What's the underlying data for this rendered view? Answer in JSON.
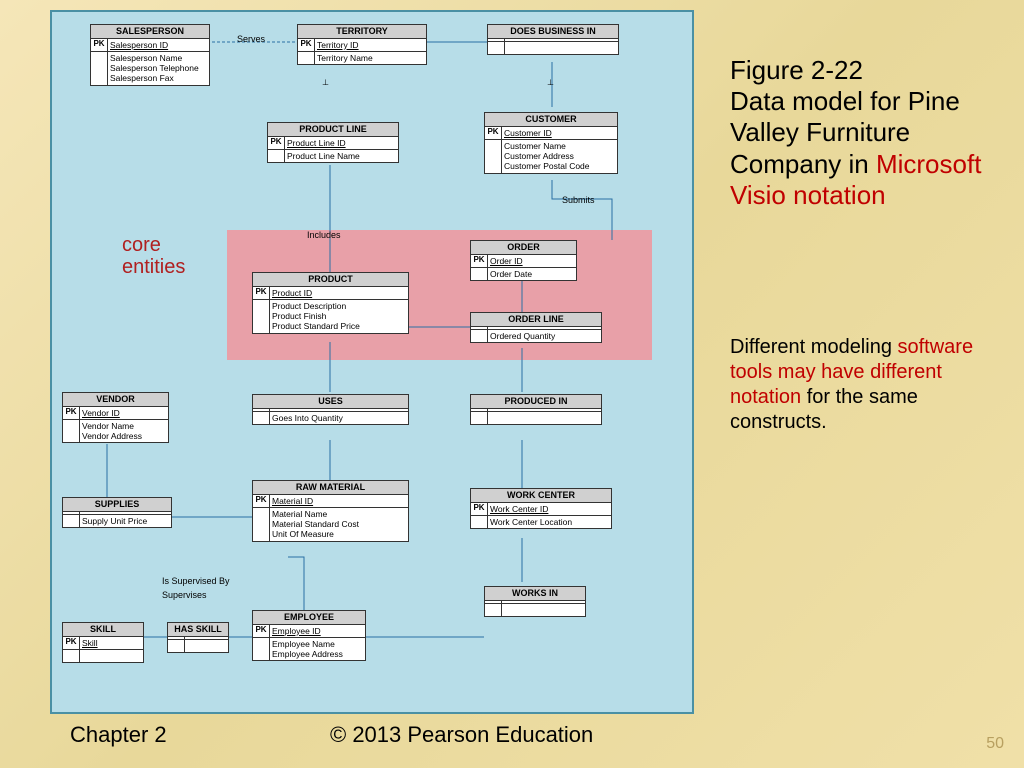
{
  "figure_number": "Figure 2-22",
  "figure_title_plain": "Data model for Pine Valley Furniture Company in ",
  "figure_title_red": "Microsoft Visio notation",
  "subtitle_pre": "Different modeling ",
  "subtitle_red": "software tools may have different notation",
  "subtitle_post": " for the same constructs.",
  "annotation": "core entities",
  "footer_chapter": "Chapter 2",
  "footer_copyright": "© 2013 Pearson Education",
  "page_number": "50",
  "entities": {
    "salesperson": {
      "title": "SALESPERSON",
      "pk": "Salesperson ID",
      "attrs": "Salesperson Name\nSalesperson Telephone\nSalesperson Fax"
    },
    "territory": {
      "title": "TERRITORY",
      "pk": "Territory ID",
      "attrs": "Territory Name"
    },
    "does_business_in": {
      "title": "DOES BUSINESS IN",
      "pk": "",
      "attrs": ""
    },
    "product_line": {
      "title": "PRODUCT LINE",
      "pk": "Product Line ID",
      "attrs": "Product Line Name"
    },
    "customer": {
      "title": "CUSTOMER",
      "pk": "Customer ID",
      "attrs": "Customer Name\nCustomer Address\nCustomer Postal Code"
    },
    "order": {
      "title": "ORDER",
      "pk": "Order ID",
      "attrs": "Order Date"
    },
    "product": {
      "title": "PRODUCT",
      "pk": "Product ID",
      "attrs": "Product Description\nProduct Finish\nProduct Standard Price"
    },
    "order_line": {
      "title": "ORDER LINE",
      "pk": "",
      "attrs": "Ordered Quantity"
    },
    "vendor": {
      "title": "VENDOR",
      "pk": "Vendor ID",
      "attrs": "Vendor Name\nVendor Address"
    },
    "uses": {
      "title": "USES",
      "pk": "",
      "attrs": "Goes Into Quantity"
    },
    "produced_in": {
      "title": "PRODUCED IN",
      "pk": "",
      "attrs": ""
    },
    "supplies": {
      "title": "SUPPLIES",
      "pk": "",
      "attrs": "Supply Unit Price"
    },
    "raw_material": {
      "title": "RAW MATERIAL",
      "pk": "Material ID",
      "attrs": "Material Name\nMaterial Standard Cost\nUnit Of Measure"
    },
    "work_center": {
      "title": "WORK CENTER",
      "pk": "Work Center ID",
      "attrs": "Work Center Location"
    },
    "skill": {
      "title": "SKILL",
      "pk": "Skill",
      "attrs": ""
    },
    "has_skill": {
      "title": "HAS SKILL",
      "pk": "",
      "attrs": ""
    },
    "employee": {
      "title": "EMPLOYEE",
      "pk": "Employee ID",
      "attrs": "Employee Name\nEmployee Address"
    },
    "works_in": {
      "title": "WORKS IN",
      "pk": "",
      "attrs": ""
    }
  },
  "rel_labels": {
    "serves": "Serves",
    "includes": "Includes",
    "submits": "Submits",
    "is_supervised_by": "Is Supervised By",
    "supervises": "Supervises"
  },
  "pk_label": "PK"
}
